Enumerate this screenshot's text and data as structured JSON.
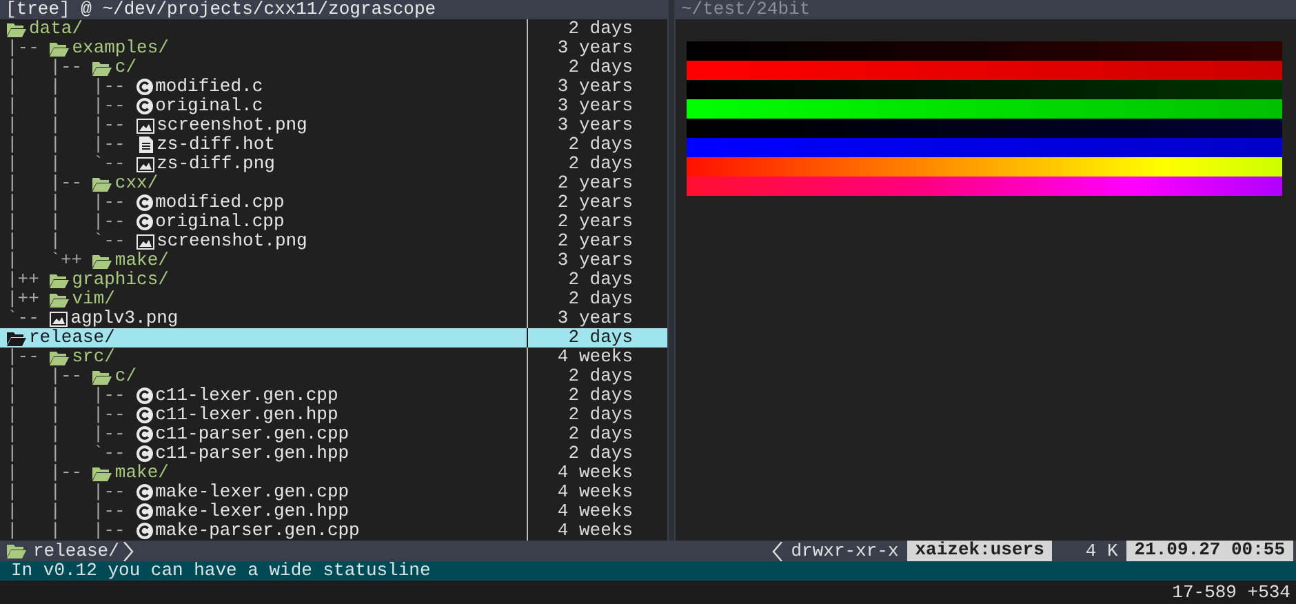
{
  "left_pane": {
    "title": "[tree] @ ~/dev/projects/cxx11/zograscope",
    "items": [
      {
        "kind": "dir",
        "name": "data/",
        "age": "2 days",
        "selected": false,
        "children": [
          {
            "prefix": "|-- ",
            "kind": "dir",
            "name": "examples/",
            "age": "3 years",
            "selected": false,
            "children": [
              {
                "prefix": "|   |-- ",
                "kind": "dir",
                "name": "c/",
                "age": "2 days",
                "selected": false,
                "children": [
                  {
                    "prefix": "|   |   |-- ",
                    "kind": "source",
                    "name": "modified.c",
                    "age": "3 years",
                    "selected": false
                  },
                  {
                    "prefix": "|   |   |-- ",
                    "kind": "source",
                    "name": "original.c",
                    "age": "3 years",
                    "selected": false
                  },
                  {
                    "prefix": "|   |   |-- ",
                    "kind": "image",
                    "name": "screenshot.png",
                    "age": "3 years",
                    "selected": false
                  },
                  {
                    "prefix": "|   |   |-- ",
                    "kind": "text",
                    "name": "zs-diff.hot",
                    "age": "2 days",
                    "selected": false
                  },
                  {
                    "prefix": "|   |   `-- ",
                    "kind": "image",
                    "name": "zs-diff.png",
                    "age": "2 days",
                    "selected": false
                  }
                ]
              },
              {
                "prefix": "|   |-- ",
                "kind": "dir",
                "name": "cxx/",
                "age": "2 years",
                "selected": false,
                "children": [
                  {
                    "prefix": "|   |   |-- ",
                    "kind": "source",
                    "name": "modified.cpp",
                    "age": "2 years",
                    "selected": false
                  },
                  {
                    "prefix": "|   |   |-- ",
                    "kind": "source",
                    "name": "original.cpp",
                    "age": "2 years",
                    "selected": false
                  },
                  {
                    "prefix": "|   |   `-- ",
                    "kind": "image",
                    "name": "screenshot.png",
                    "age": "2 years",
                    "selected": false
                  }
                ]
              },
              {
                "prefix": "|   `++ ",
                "kind": "dir",
                "name": "make/",
                "age": "3 years",
                "selected": false
              }
            ]
          },
          {
            "prefix": "|++ ",
            "kind": "dir",
            "name": "graphics/",
            "age": "2 days",
            "selected": false
          },
          {
            "prefix": "|++ ",
            "kind": "dir",
            "name": "vim/",
            "age": "2 days",
            "selected": false
          },
          {
            "prefix": "`-- ",
            "kind": "image",
            "name": "agplv3.png",
            "age": "3 years",
            "selected": false
          }
        ]
      },
      {
        "kind": "dir",
        "name": "release/",
        "age": "2 days",
        "selected": true,
        "children": [
          {
            "prefix": "|-- ",
            "kind": "dir",
            "name": "src/",
            "age": "4 weeks",
            "selected": false,
            "children": [
              {
                "prefix": "|   |-- ",
                "kind": "dir",
                "name": "c/",
                "age": "2 days",
                "selected": false,
                "children": [
                  {
                    "prefix": "|   |   |-- ",
                    "kind": "source",
                    "name": "c11-lexer.gen.cpp",
                    "age": "2 days",
                    "selected": false
                  },
                  {
                    "prefix": "|   |   |-- ",
                    "kind": "source",
                    "name": "c11-lexer.gen.hpp",
                    "age": "2 days",
                    "selected": false
                  },
                  {
                    "prefix": "|   |   |-- ",
                    "kind": "source",
                    "name": "c11-parser.gen.cpp",
                    "age": "2 days",
                    "selected": false
                  },
                  {
                    "prefix": "|   |   `-- ",
                    "kind": "source",
                    "name": "c11-parser.gen.hpp",
                    "age": "2 days",
                    "selected": false
                  }
                ]
              },
              {
                "prefix": "|   |-- ",
                "kind": "dir",
                "name": "make/",
                "age": "4 weeks",
                "selected": false,
                "children": [
                  {
                    "prefix": "|   |   |-- ",
                    "kind": "source",
                    "name": "make-lexer.gen.cpp",
                    "age": "4 weeks",
                    "selected": false
                  },
                  {
                    "prefix": "|   |   |-- ",
                    "kind": "source",
                    "name": "make-lexer.gen.hpp",
                    "age": "4 weeks",
                    "selected": false
                  },
                  {
                    "prefix": "|   |   |-- ",
                    "kind": "source",
                    "name": "make-parser.gen.cpp",
                    "age": "4 weeks",
                    "selected": false
                  }
                ]
              }
            ]
          }
        ]
      }
    ]
  },
  "right_pane": {
    "title": "~/test/24bit"
  },
  "status_bar": {
    "path": "release/",
    "permissions": "drwxr-xr-x",
    "owner": "xaizek:users",
    "size": "4 K",
    "time": "21.09.27 00:55"
  },
  "statusline": "In v0.12 you can have a wide statusline",
  "command_line": {
    "position": "17-589 +534"
  }
}
